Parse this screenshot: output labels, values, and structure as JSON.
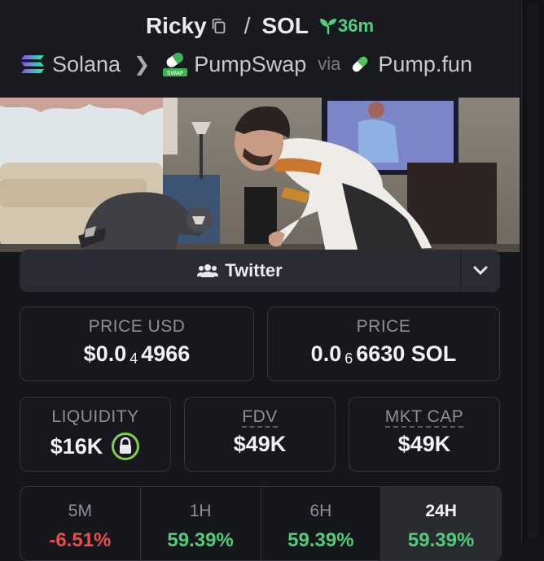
{
  "header": {
    "token_name": "Ricky",
    "separator": "/",
    "quote": "SOL",
    "age": "36m",
    "chain": "Solana",
    "dex": "PumpSwap",
    "via": "via",
    "launchpad": "Pump.fun"
  },
  "socials": {
    "twitter_label": "Twitter"
  },
  "stats": {
    "price_usd": {
      "label": "PRICE USD",
      "prefix": "$0.0",
      "zeros": "4",
      "digits": "4966"
    },
    "price_native": {
      "label": "PRICE",
      "prefix": "0.0",
      "zeros": "6",
      "digits": "6630 SOL"
    },
    "liquidity": {
      "label": "LIQUIDITY",
      "value": "$16K"
    },
    "fdv": {
      "label": "FDV",
      "value": "$49K"
    },
    "mkt_cap": {
      "label": "MKT CAP",
      "value": "$49K"
    }
  },
  "timeframes": [
    {
      "label": "5M",
      "value": "-6.51%",
      "color": "#ee4b4b"
    },
    {
      "label": "1H",
      "value": "59.39%",
      "color": "#4ccd79"
    },
    {
      "label": "6H",
      "value": "59.39%",
      "color": "#4ccd79"
    },
    {
      "label": "24H",
      "value": "59.39%",
      "color": "#4ccd79"
    }
  ],
  "colors": {
    "positive": "#4ccd79",
    "negative": "#ee4b4b",
    "lock_ring": "#7fd048"
  }
}
